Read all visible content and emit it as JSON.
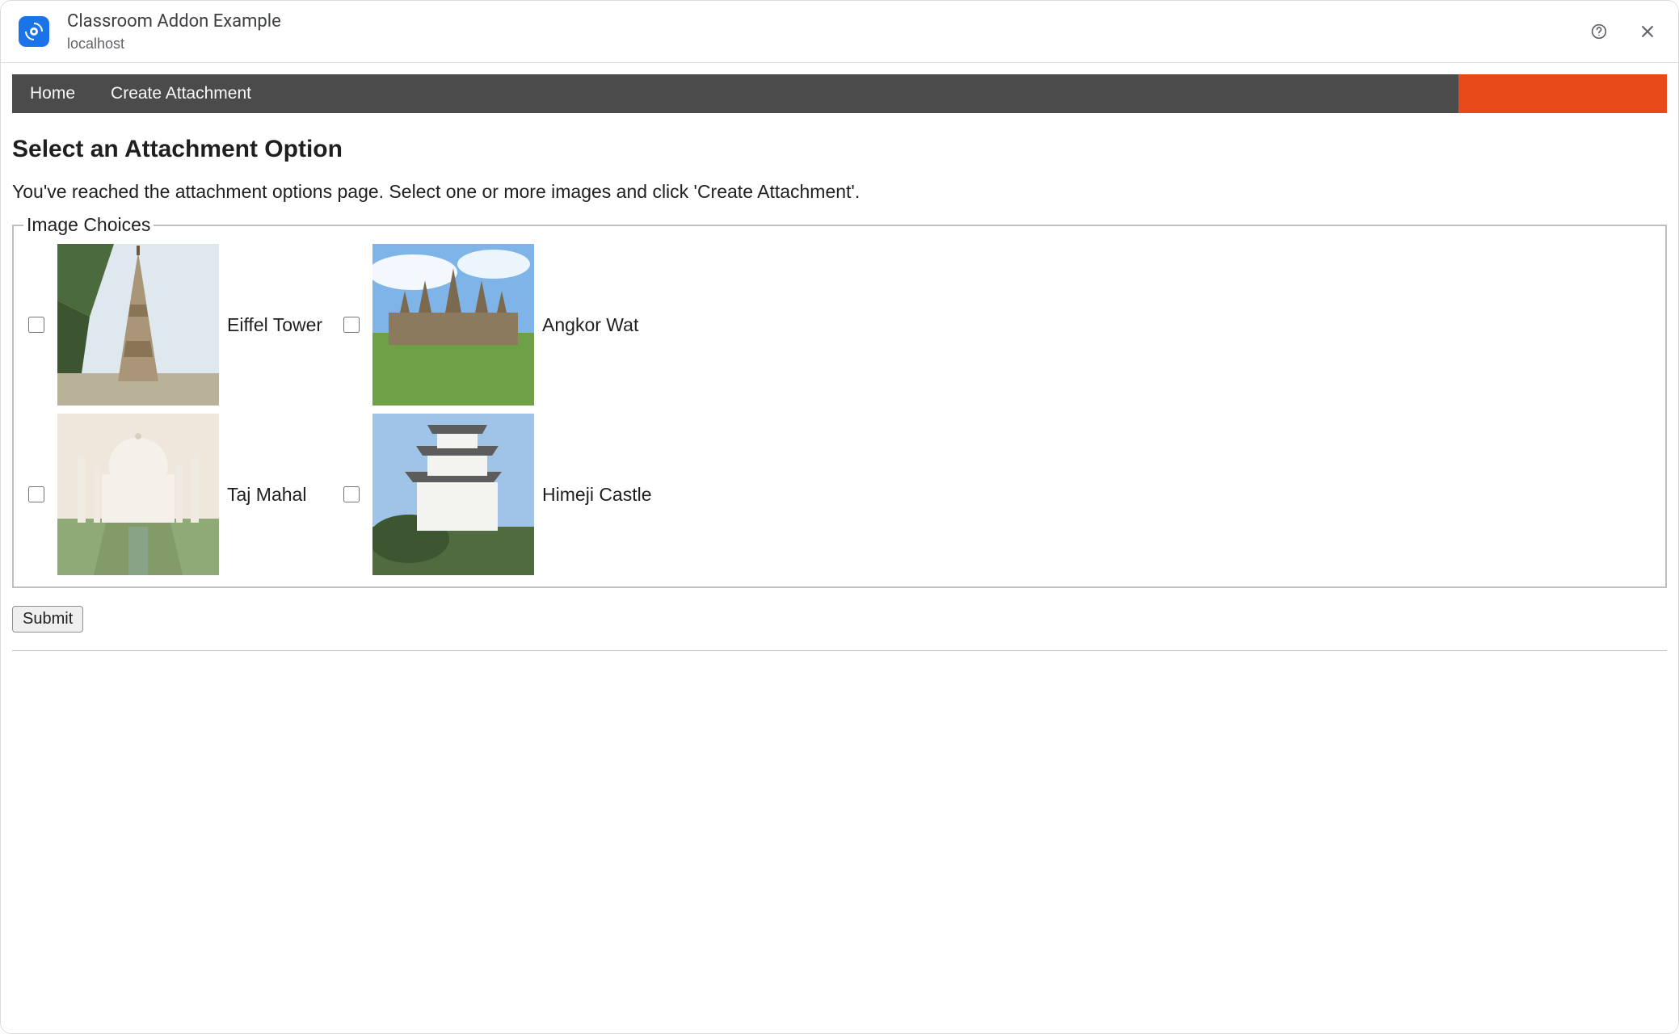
{
  "dialog": {
    "title": "Classroom Addon Example",
    "subtitle": "localhost"
  },
  "nav": {
    "items": [
      {
        "label": "Home"
      },
      {
        "label": "Create Attachment"
      }
    ]
  },
  "page": {
    "heading": "Select an Attachment Option",
    "instructions": "You've reached the attachment options page. Select one or more images and click 'Create Attachment'."
  },
  "fieldset": {
    "legend": "Image Choices"
  },
  "choices": [
    {
      "label": "Eiffel Tower",
      "checked": false
    },
    {
      "label": "Angkor Wat",
      "checked": false
    },
    {
      "label": "Taj Mahal",
      "checked": false
    },
    {
      "label": "Himeji Castle",
      "checked": false
    }
  ],
  "submit_label": "Submit"
}
